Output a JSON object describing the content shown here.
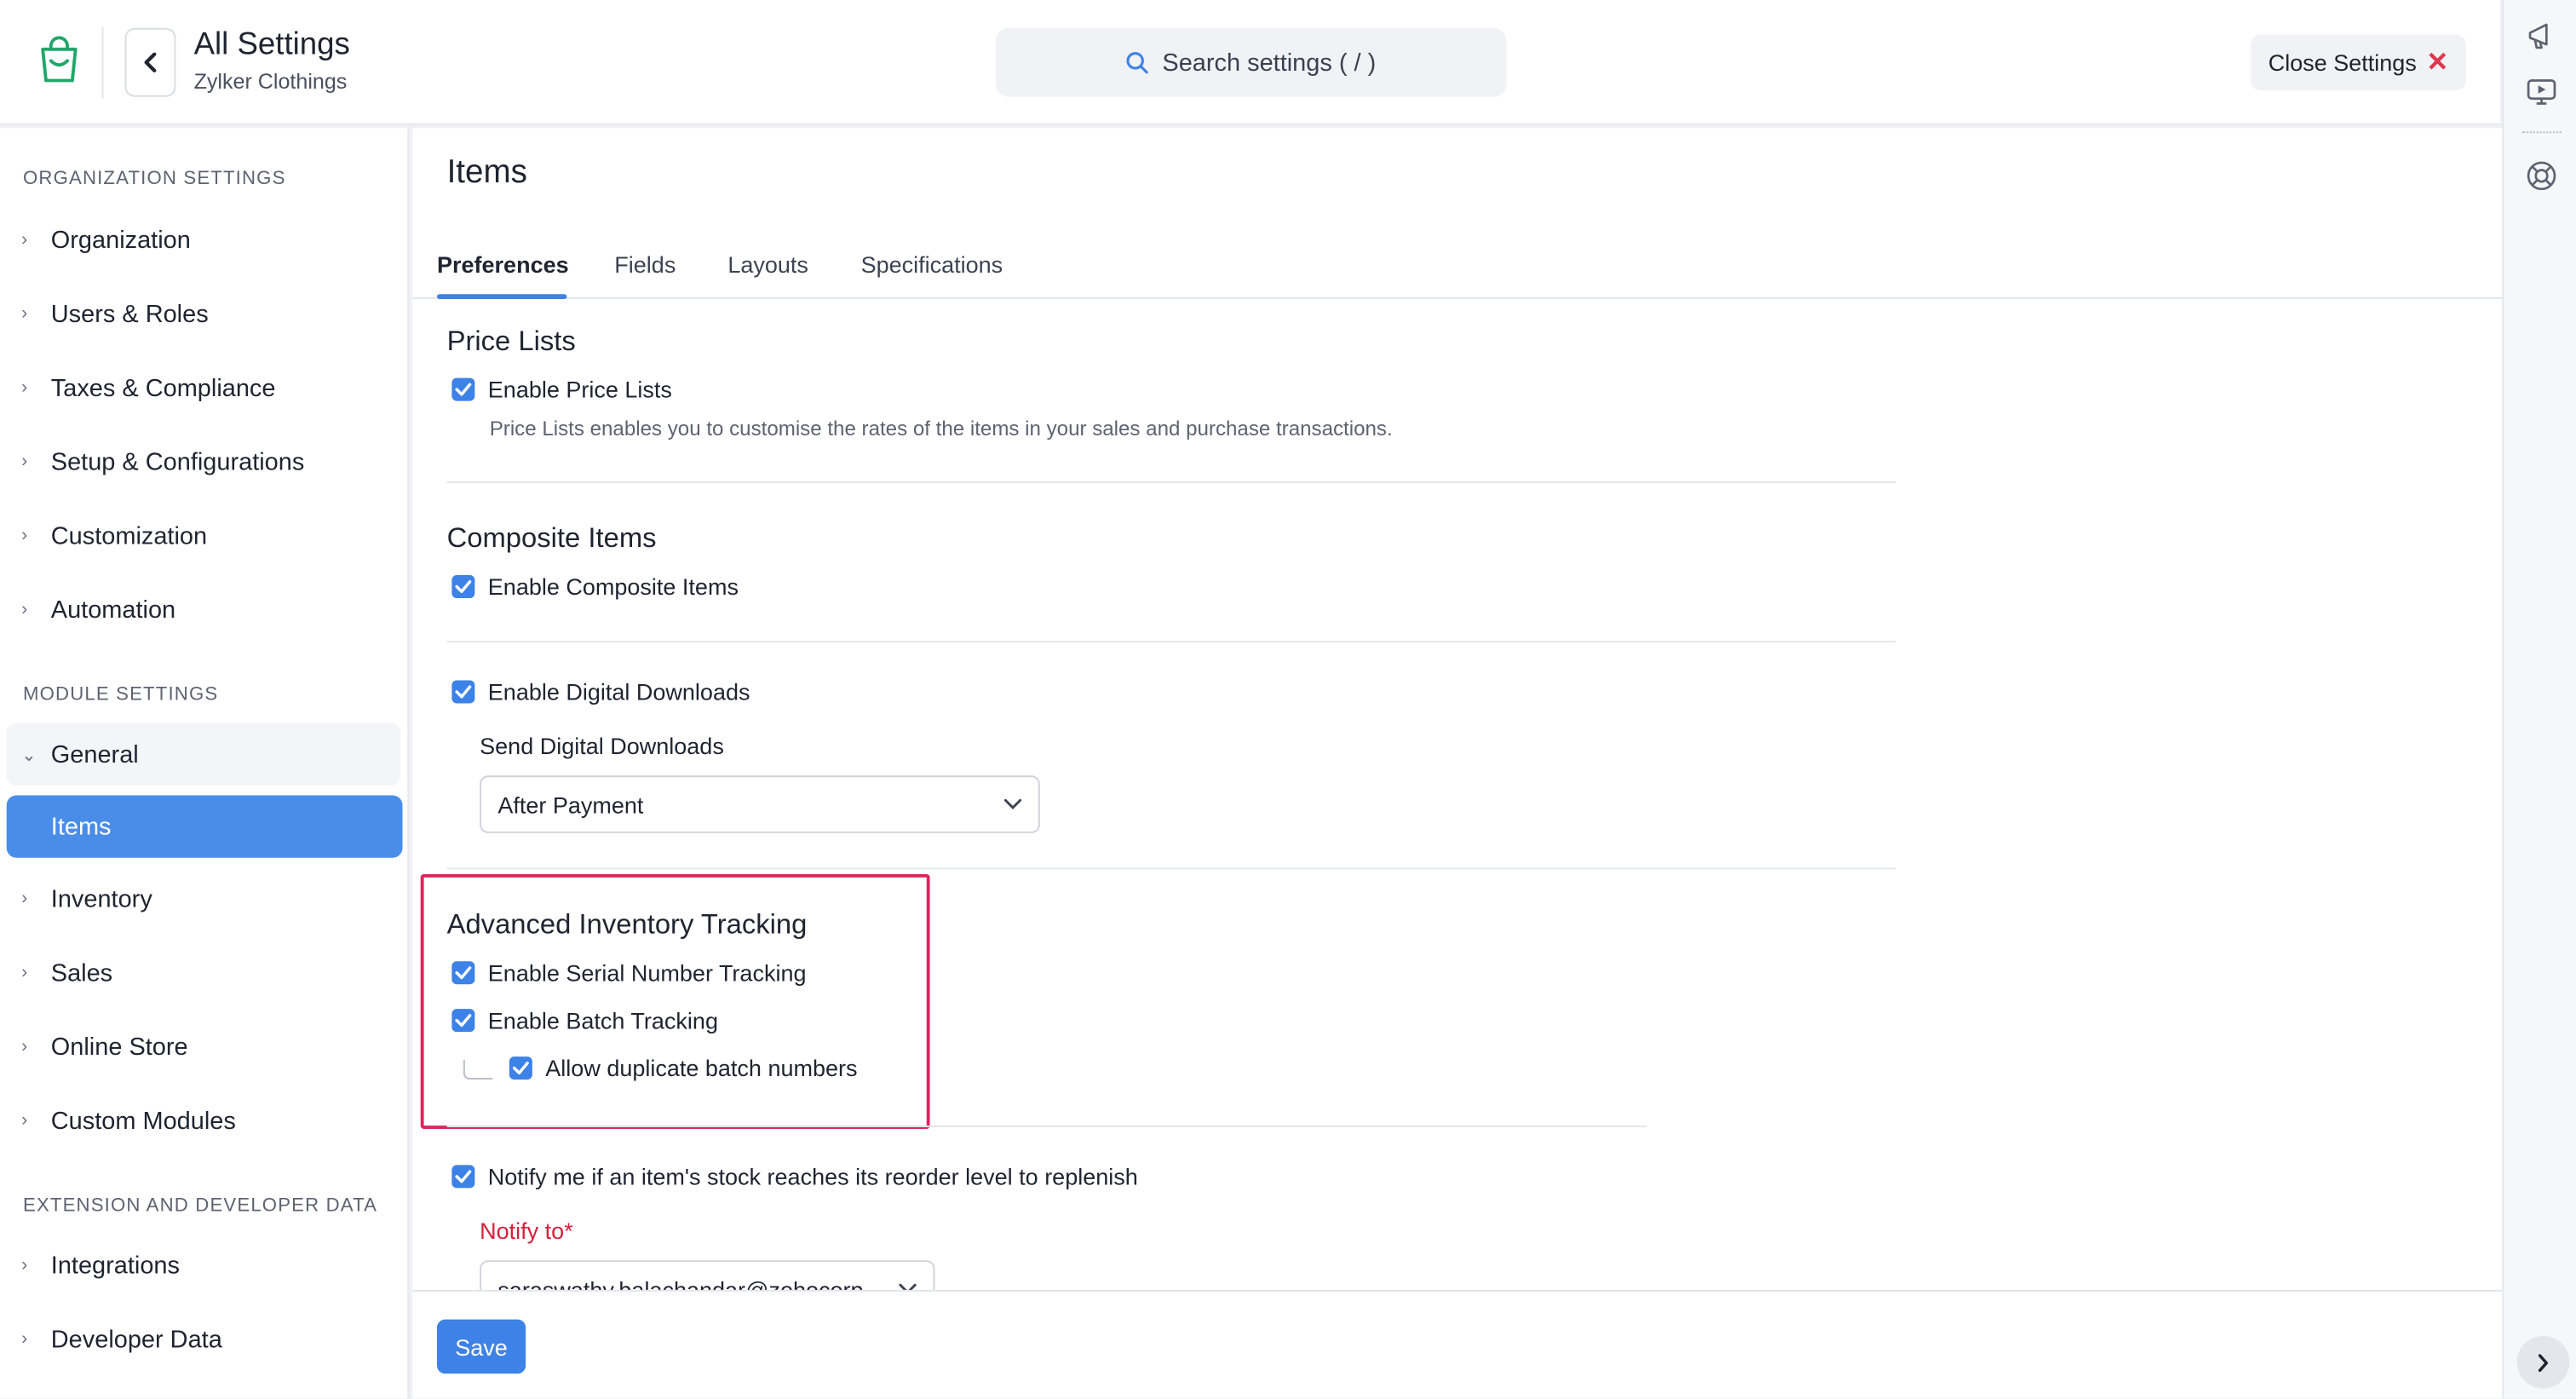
{
  "header": {
    "title": "All Settings",
    "subtitle": "Zylker Clothings",
    "search_placeholder": "Search settings ( / )",
    "close_label": "Close Settings"
  },
  "sidebar": {
    "org_heading": "ORGANIZATION SETTINGS",
    "org_items": [
      "Organization",
      "Users & Roles",
      "Taxes & Compliance",
      "Setup & Configurations",
      "Customization",
      "Automation"
    ],
    "module_heading": "MODULE SETTINGS",
    "general_label": "General",
    "active_sub_item": "Items",
    "module_items": [
      "Inventory",
      "Sales",
      "Online Store",
      "Custom Modules"
    ],
    "ext_heading": "EXTENSION AND DEVELOPER DATA",
    "ext_items": [
      "Integrations",
      "Developer Data"
    ]
  },
  "main": {
    "page_title": "Items",
    "tabs": [
      "Preferences",
      "Fields",
      "Layouts",
      "Specifications"
    ],
    "active_tab": "Preferences",
    "price_lists": {
      "heading": "Price Lists",
      "checkbox_label": "Enable Price Lists",
      "checked": true,
      "help": "Price Lists enables you to customise the rates of the items in your sales and purchase transactions."
    },
    "composite": {
      "heading": "Composite Items",
      "checkbox_label": "Enable Composite Items",
      "checked": true
    },
    "digital": {
      "checkbox_label": "Enable Digital Downloads",
      "checked": true,
      "send_label": "Send Digital Downloads",
      "send_value": "After Payment"
    },
    "advanced": {
      "heading": "Advanced Inventory Tracking",
      "serial_label": "Enable Serial Number Tracking",
      "batch_label": "Enable Batch Tracking",
      "duplicate_label": "Allow duplicate batch numbers"
    },
    "reorder": {
      "checkbox_label": "Notify me if an item's stock reaches its reorder level to replenish",
      "notify_label": "Notify to*",
      "notify_value": "saraswathy.balachandar@zohocorp..."
    },
    "save_label": "Save"
  },
  "colors": {
    "accent": "#3d82e6",
    "highlight_border": "#e0245e",
    "required": "#d6203a"
  },
  "icons": [
    "store-logo-icon",
    "chevron-left-icon",
    "search-icon",
    "close-icon",
    "megaphone-icon",
    "video-icon",
    "help-icon",
    "chevron-right-icon",
    "chevron-down-icon",
    "check-icon"
  ]
}
